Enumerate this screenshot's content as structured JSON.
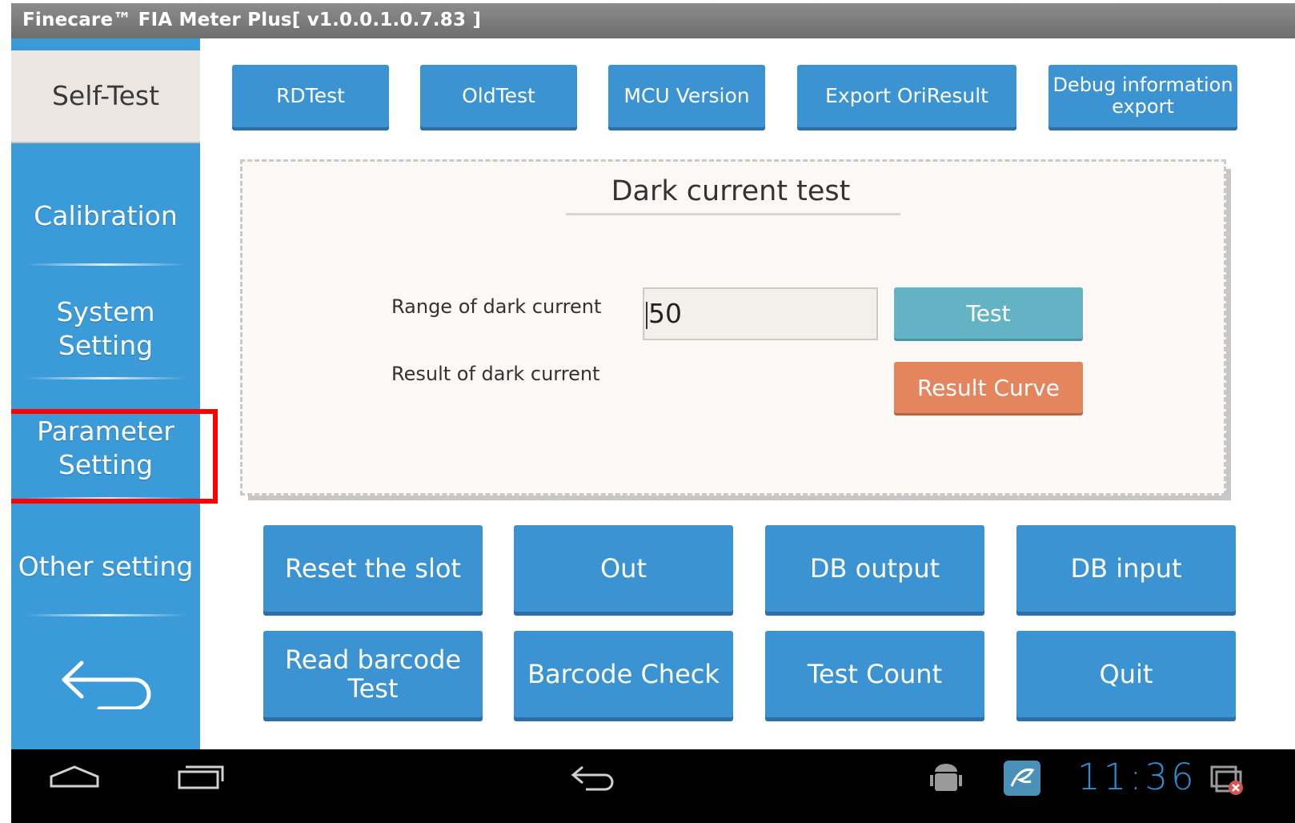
{
  "window": {
    "title": "Finecare™ FIA Meter Plus[ v1.0.0.1.0.7.83 ]"
  },
  "sidebar": {
    "items": [
      {
        "label": "Self-Test"
      },
      {
        "label": "Calibration"
      },
      {
        "label": "System Setting"
      },
      {
        "label": "Parameter Setting"
      },
      {
        "label": "Other setting"
      }
    ],
    "back_icon": "return-arrow-icon",
    "highlight_color": "#ff0000"
  },
  "toolbar": {
    "buttons": [
      {
        "label": "RDTest"
      },
      {
        "label": "OldTest"
      },
      {
        "label": "MCU Version"
      },
      {
        "label": "Export OriResult"
      },
      {
        "label": "Debug information export"
      }
    ]
  },
  "panel": {
    "title": "Dark current test",
    "range_label": "Range of dark current",
    "range_value": "50",
    "result_label": "Result of dark current",
    "test_button": "Test",
    "curve_button": "Result Curve"
  },
  "actions": {
    "buttons": [
      {
        "label": "Reset the slot"
      },
      {
        "label": "Out"
      },
      {
        "label": "DB output"
      },
      {
        "label": "DB input"
      },
      {
        "label": "Read barcode Test"
      },
      {
        "label": "Barcode Check"
      },
      {
        "label": "Test Count"
      },
      {
        "label": "Quit"
      }
    ]
  },
  "statusbar": {
    "time": "11:36",
    "icons": [
      "home-icon",
      "recent-apps-icon",
      "back-icon",
      "android-debug-icon",
      "app-notification-icon",
      "sync-error-icon"
    ]
  },
  "colors": {
    "accent": "#3b9ad8",
    "button": "#3c93d2",
    "test_button": "#63b3c4",
    "curve_button": "#e5855d"
  }
}
